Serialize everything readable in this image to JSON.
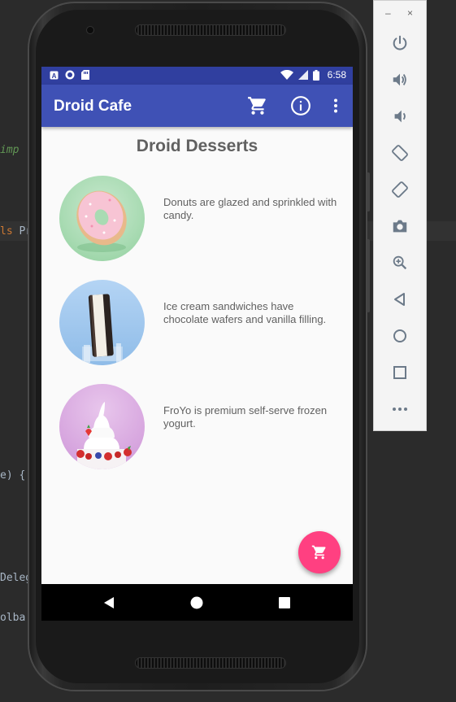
{
  "ide": {
    "line1": "imp",
    "line2_kw": "ls",
    "line2": "Pr",
    "line3": "e) {",
    "line4": "Deleg",
    "line5": "olba"
  },
  "status_bar": {
    "time": "6:58"
  },
  "app_bar": {
    "title": "Droid Cafe",
    "actions": [
      "cart-icon",
      "info-icon",
      "overflow-menu-icon"
    ]
  },
  "content": {
    "title": "Droid Desserts",
    "desserts": [
      {
        "name": "donut",
        "description": "Donuts are glazed and sprinkled with candy."
      },
      {
        "name": "ice-cream-sandwich",
        "description": "Ice cream sandwiches have chocolate wafers and vanilla filling."
      },
      {
        "name": "froyo",
        "description": "FroYo is premium self-serve frozen yogurt."
      }
    ]
  },
  "fab": {
    "icon": "cart-icon"
  },
  "colors": {
    "primary": "#3f51b5",
    "primary_dark": "#303f9f",
    "accent": "#ff4081",
    "text_secondary": "#616161"
  },
  "emulator_toolbar": {
    "minimize": "–",
    "close": "×",
    "buttons": [
      "power-icon",
      "volume-up-icon",
      "volume-down-icon",
      "rotate-left-icon",
      "rotate-right-icon",
      "camera-icon",
      "zoom-icon",
      "back-icon",
      "home-icon",
      "overview-icon",
      "more-icon"
    ]
  }
}
